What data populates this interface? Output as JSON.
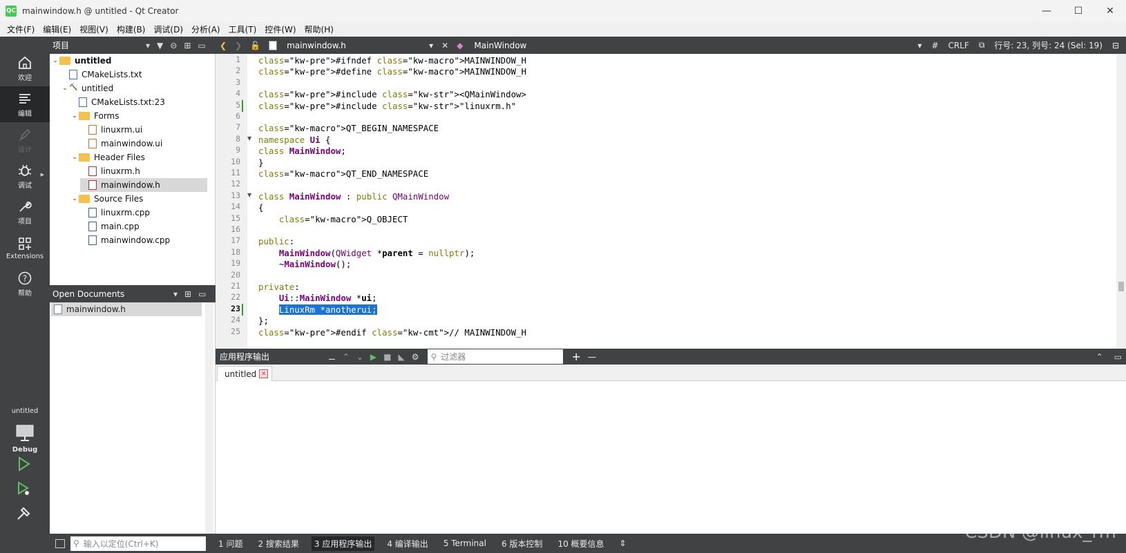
{
  "window": {
    "title": "mainwindow.h @ untitled - Qt Creator",
    "logo": "QC",
    "controls": [
      "—",
      "☐",
      "✕"
    ]
  },
  "menu": [
    "文件(F)",
    "编辑(E)",
    "视图(V)",
    "构建(B)",
    "调试(D)",
    "分析(A)",
    "工具(T)",
    "控件(W)",
    "帮助(H)"
  ],
  "modes": [
    {
      "label": "欢迎",
      "icon": "home-icon"
    },
    {
      "label": "编辑",
      "icon": "edit-icon",
      "active": true
    },
    {
      "label": "设计",
      "icon": "design-pen-icon",
      "disabled": true
    },
    {
      "label": "调试",
      "icon": "bug-icon"
    },
    {
      "label": "项目",
      "icon": "wrench-icon"
    },
    {
      "label": "Extensions",
      "icon": "extensions-grid-icon"
    },
    {
      "label": "帮助",
      "icon": "help-icon"
    }
  ],
  "kit": {
    "project": "untitled",
    "build": "Debug"
  },
  "projects": {
    "title": "项目",
    "tree": [
      {
        "label": "untitled",
        "depth": 0,
        "type": "project",
        "expanded": true,
        "bold": true
      },
      {
        "label": "CMakeLists.txt",
        "depth": 1,
        "type": "cmake"
      },
      {
        "label": "untitled",
        "depth": 1,
        "type": "target",
        "expanded": true
      },
      {
        "label": "CMakeLists.txt:23",
        "depth": 2,
        "type": "cmake"
      },
      {
        "label": "Forms",
        "depth": 2,
        "type": "folder",
        "expanded": true
      },
      {
        "label": "linuxrm.ui",
        "depth": 3,
        "type": "ui"
      },
      {
        "label": "mainwindow.ui",
        "depth": 3,
        "type": "ui"
      },
      {
        "label": "Header Files",
        "depth": 2,
        "type": "folder",
        "expanded": true
      },
      {
        "label": "linuxrm.h",
        "depth": 3,
        "type": "header"
      },
      {
        "label": "mainwindow.h",
        "depth": 3,
        "type": "header",
        "selected": true
      },
      {
        "label": "Source Files",
        "depth": 2,
        "type": "folder",
        "expanded": true
      },
      {
        "label": "linuxrm.cpp",
        "depth": 3,
        "type": "cpp"
      },
      {
        "label": "main.cpp",
        "depth": 3,
        "type": "cpp"
      },
      {
        "label": "mainwindow.cpp",
        "depth": 3,
        "type": "cpp"
      }
    ]
  },
  "open_documents": {
    "title": "Open Documents",
    "items": [
      "mainwindow.h"
    ]
  },
  "editor_toolbar": {
    "file": "mainwindow.h",
    "symbol": "MainWindow",
    "hash": "#",
    "line_ending": "CRLF",
    "position": "行号: 23, 列号: 24 (Sel: 19)"
  },
  "code": {
    "current_line": 23,
    "lines": [
      "#ifndef MAINWINDOW_H",
      "#define MAINWINDOW_H",
      "",
      "#include <QMainWindow>",
      "#include \"linuxrm.h\"",
      "",
      "QT_BEGIN_NAMESPACE",
      "namespace Ui {",
      "class MainWindow;",
      "}",
      "QT_END_NAMESPACE",
      "",
      "class MainWindow : public QMainWindow",
      "{",
      "    Q_OBJECT",
      "",
      "public:",
      "    MainWindow(QWidget *parent = nullptr);",
      "    ~MainWindow();",
      "",
      "private:",
      "    Ui::MainWindow *ui;",
      "    LinuxRm *anotherui;",
      "};",
      "#endif // MAINWINDOW_H"
    ]
  },
  "output": {
    "title": "应用程序输出",
    "filter_placeholder": "过滤器",
    "tab": "untitled",
    "add": "+",
    "remove": "—"
  },
  "statusbar": {
    "locator_placeholder": "输入以定位(Ctrl+K)",
    "tabs": [
      "1  问题",
      "2  搜索结果",
      "3  应用程序输出",
      "4  编译输出",
      "5  Terminal",
      "6  版本控制",
      "10  概要信息"
    ],
    "active_tab": 2
  },
  "watermark": "CSDN @linux_rm"
}
